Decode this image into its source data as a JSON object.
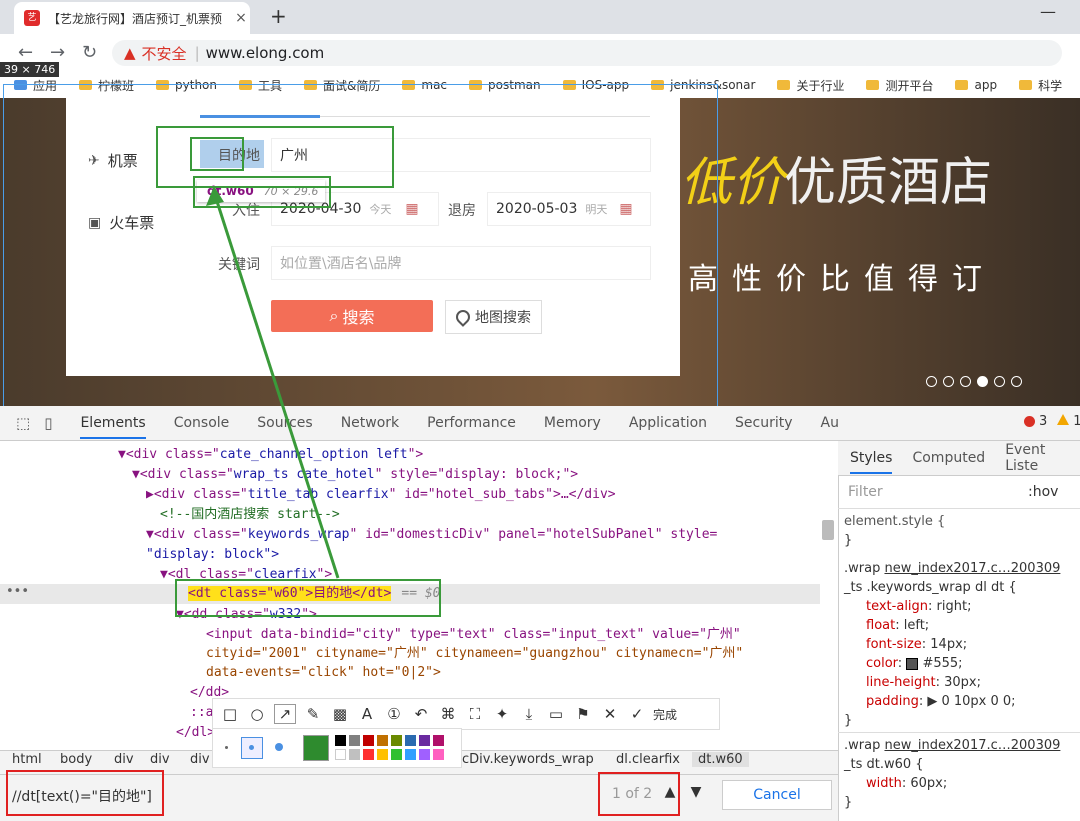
{
  "browser": {
    "tab_title": "【艺龙旅行网】酒店预订_机票预",
    "tab_close": "×",
    "new_tab": "+",
    "url_warning": "不安全",
    "url": "www.elong.com",
    "window_control": "—",
    "selection_dimensions": "39 × 746",
    "bookmarks": [
      "应用",
      "柠檬班",
      "python",
      "工具",
      "面试&简历",
      "mac",
      "postman",
      "IOS-app",
      "jenkins&sonar",
      "关于行业",
      "测开平台",
      "app",
      "科学"
    ]
  },
  "page": {
    "side_labels": [
      "机票",
      "火车票"
    ],
    "destination_label": "目的地",
    "destination_value": "广州",
    "checkin_label": "入住",
    "checkin_value": "2020-04-30",
    "checkin_hint": "今天",
    "checkout_label": "退房",
    "checkout_value": "2020-05-03",
    "checkout_hint": "明天",
    "keyword_label": "关键词",
    "keyword_placeholder": "如位置\\酒店名\\品牌",
    "search_button": "搜索",
    "map_search_button": "地图搜索",
    "hero_slogan_accent": "低价",
    "hero_slogan_main": "优质酒店",
    "hero_subslogan": "高性价比值得订",
    "inspect_tooltip": {
      "tag": "dt.w60",
      "size": "70 × 29.6"
    }
  },
  "devtools": {
    "tabs": [
      "Elements",
      "Console",
      "Sources",
      "Network",
      "Performance",
      "Memory",
      "Application",
      "Security",
      "Audits"
    ],
    "error_count": "3",
    "warning_count": "1",
    "html_lines": [
      {
        "open": "▼<div class=\"",
        "cls": "cate_channel_option left",
        "close": "\">"
      },
      {
        "open": "▼<div class=\"",
        "cls": "wrap_ts cate_hotel",
        "close": "\" style=\"display: block;\">"
      },
      {
        "open": "▶<div class=\"",
        "cls": "title_tab clearfix",
        "close": "\" id=\"hotel_sub_tabs\">…</div>"
      },
      {
        "comment": "<!--国内酒店搜索 start-->"
      },
      {
        "open": "▼<div class=\"",
        "cls": "keywords_wrap",
        "close": "\" id=\"domesticDiv\" panel=\"hotelSubPanel\" style="
      },
      {
        "plain": "\"display: block\">"
      },
      {
        "open": "▼<dl class=\"",
        "cls": "clearfix",
        "close": "\">"
      },
      {
        "selected": "<dt class=\"w60\">目的地</dt>",
        "marker": "== $0"
      },
      {
        "open": "▼<dd class=\"",
        "cls": "w332",
        "close": "\">"
      },
      {
        "plain": "<input data-bindid=\"city\" type=\"text\" class=\"input_text\" value=\"广州\""
      },
      {
        "plain": "cityid=\"2001\" cityname=\"广州\" citynameen=\"guangzhou\" citynamecn=\"广州\""
      },
      {
        "plain": "data-events=\"click\" hot=\"0|2\">"
      },
      {
        "plain": "</dd>"
      },
      {
        "plain": "::a"
      },
      {
        "plain": "</dl>"
      }
    ],
    "styles_tabs": [
      "Styles",
      "Computed",
      "Event Liste"
    ],
    "filter_placeholder": "Filter",
    "hov": ":hov",
    "rules": [
      {
        "selector": "element.style {"
      },
      {
        "close": "}"
      },
      {
        "selector": ".wrap",
        "source": "new_index2017.c…200309"
      },
      {
        "selector": "_ts .keywords_wrap dl dt {"
      },
      {
        "prop": "text-align",
        "value": "right;"
      },
      {
        "prop": "float",
        "value": "left;"
      },
      {
        "prop": "font-size",
        "value": "14px;"
      },
      {
        "prop": "color",
        "value": "#555;"
      },
      {
        "prop": "line-height",
        "value": "30px;"
      },
      {
        "prop": "padding",
        "value": "▶ 0 10px 0 0;"
      },
      {
        "close": "}"
      },
      {
        "selector": ".wrap",
        "source": "new_index2017.c…200309"
      },
      {
        "selector": "_ts dt.w60 {"
      },
      {
        "prop": "width",
        "value": "60px;"
      },
      {
        "close": "}"
      }
    ],
    "breadcrumbs": [
      "html",
      "body",
      "div",
      "div",
      "div",
      "cDiv.keywords_wrap",
      "dl.clearfix",
      "dt.w60"
    ],
    "search_query": "//dt[text()=\"目的地\"]",
    "match_count": "1 of 2",
    "cancel_label": "Cancel"
  },
  "annotation_toolbar": {
    "done_label": "完成"
  },
  "colors": {
    "accent_green": "#3a9a3a",
    "accent_red": "#e02020",
    "search_button": "#f36e57",
    "devtools_blue": "#1a73e8"
  }
}
